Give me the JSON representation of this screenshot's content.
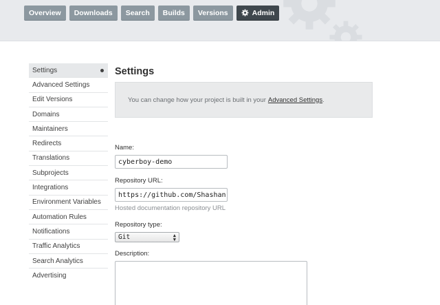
{
  "nav": {
    "items": [
      {
        "label": "Overview",
        "active": false
      },
      {
        "label": "Downloads",
        "active": false
      },
      {
        "label": "Search",
        "active": false
      },
      {
        "label": "Builds",
        "active": false
      },
      {
        "label": "Versions",
        "active": false
      },
      {
        "label": "Admin",
        "active": true,
        "icon": "gear-icon"
      }
    ]
  },
  "sidebar": {
    "items": [
      {
        "label": "Settings",
        "active": true
      },
      {
        "label": "Advanced Settings"
      },
      {
        "label": "Edit Versions"
      },
      {
        "label": "Domains"
      },
      {
        "label": "Maintainers"
      },
      {
        "label": "Redirects"
      },
      {
        "label": "Translations"
      },
      {
        "label": "Subprojects"
      },
      {
        "label": "Integrations"
      },
      {
        "label": "Environment Variables"
      },
      {
        "label": "Automation Rules"
      },
      {
        "label": "Notifications"
      },
      {
        "label": "Traffic Analytics"
      },
      {
        "label": "Search Analytics"
      },
      {
        "label": "Advertising"
      }
    ]
  },
  "main": {
    "title": "Settings",
    "notice_text": "You can change how your project is built in your",
    "notice_link": "Advanced Settings",
    "notice_end": ".",
    "name_label": "Name:",
    "name_value": "cyberboy-demo",
    "repo_url_label": "Repository URL:",
    "repo_url_value": "https://github.com/Shashan",
    "repo_url_help": "Hosted documentation repository URL",
    "repo_type_label": "Repository type:",
    "repo_type_value": "Git",
    "description_label": "Description:"
  },
  "colors": {
    "nav_button": "#8c98a0",
    "nav_active": "#3f474d",
    "top_band": "#e8eaed",
    "notice_bg": "#e9eaeb"
  }
}
